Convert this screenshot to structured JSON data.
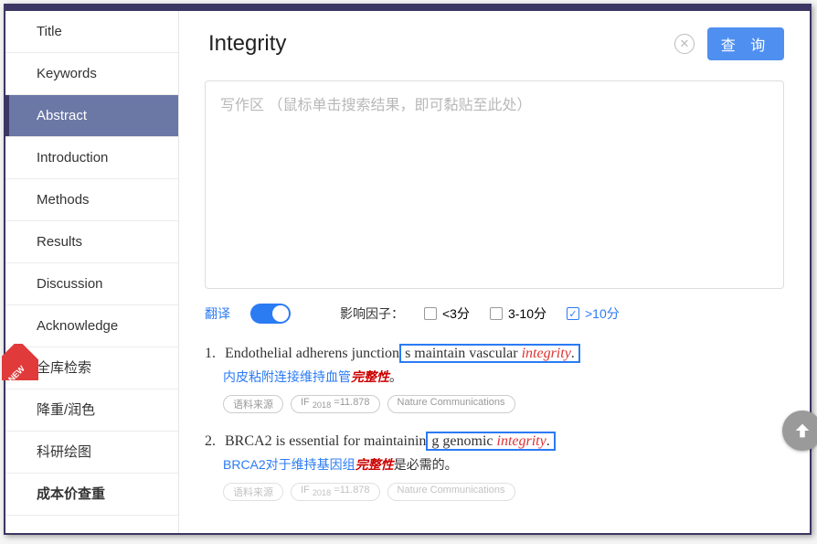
{
  "sidebar": {
    "items": [
      {
        "label": "Title"
      },
      {
        "label": "Keywords"
      },
      {
        "label": "Abstract"
      },
      {
        "label": "Introduction"
      },
      {
        "label": "Methods"
      },
      {
        "label": "Results"
      },
      {
        "label": "Discussion"
      },
      {
        "label": "Acknowledge"
      },
      {
        "label": "全库检索"
      },
      {
        "label": "降重/润色"
      },
      {
        "label": "科研绘图"
      },
      {
        "label": "成本价查重"
      }
    ],
    "new_badge": "NEW"
  },
  "search": {
    "value": "Integrity",
    "button": "查 询"
  },
  "writing": {
    "placeholder": "写作区 （鼠标单击搜索结果，即可黏贴至此处）"
  },
  "filters": {
    "translate_label": "翻译",
    "group_label": "影响因子：",
    "opts": [
      {
        "text": "<3分",
        "checked": false
      },
      {
        "text": "3-10分",
        "checked": false
      },
      {
        "text": ">10分",
        "checked": true
      }
    ]
  },
  "pills": {
    "source": "语料来源",
    "if_label": "IF",
    "if_year": "2018",
    "if_eq": "=",
    "if_value": "11.878",
    "journal": "Nature Communications"
  },
  "results": [
    {
      "num": "1.",
      "pre": "Endothelial adherens junction",
      "boxed_pre": "s maintain vascular ",
      "kw": "integrity",
      "tail": ".",
      "trans_pre": "内皮粘附连接维持血管",
      "trans_kw": "完整性",
      "trans_tail": "。"
    },
    {
      "num": "2.",
      "pre": "BRCA2 is essential for maintainin",
      "boxed_pre": "g genomic ",
      "kw": "integrity",
      "tail": ".",
      "trans_pre": "BRCA2对于维持基因组",
      "trans_kw": "完整性",
      "trans_tail": "是必需的。"
    }
  ]
}
